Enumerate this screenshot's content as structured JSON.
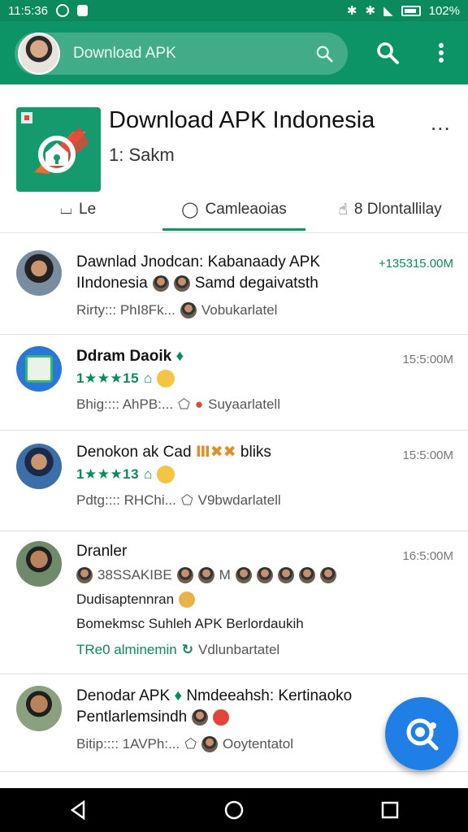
{
  "status_bar": {
    "time": "11:5:36",
    "battery": "102%"
  },
  "app_bar": {
    "search_placeholder": "Download APK"
  },
  "header": {
    "title": "Download APK Indonesia",
    "subtitle": "1: Sakm",
    "more": "...",
    "tabs": [
      {
        "label": "Le"
      },
      {
        "label": "Camleaoias"
      },
      {
        "label": "8 Dlontallilay"
      }
    ]
  },
  "items": [
    {
      "name_line1": "Dawnlad Jnodcan: Kabanaady APK",
      "name_line2": "IIndonesia",
      "name_line2_tail": "Samd degaivatsth",
      "time": "+135315.00M",
      "meta_left": "Rirty::: PhI8Fk...",
      "meta_right": "Vobukarlatel"
    },
    {
      "name_line1": "Ddram Daoik",
      "stars": "1★★★15",
      "time": "15:5:00M",
      "meta_left": "Bhig:::: AhPB:...",
      "meta_right": "Suyaarlatell"
    },
    {
      "name_line1": "Denokon ak Cad",
      "name_tail": "bliks",
      "stars": "1★★★13",
      "time": "15:5:00M",
      "meta_left": "Pdtg:::: RHChi...",
      "meta_right": "V9bwdarlatell"
    },
    {
      "name_line1": "Dranler",
      "line2": "38SSAKIBE",
      "line2_mid": "M",
      "line3": "Dudisaptennran",
      "line4": "Bomekmsc Suhleh APK Berlordaukih",
      "time": "16:5:00M",
      "meta_left": "TRe0 alminemin",
      "meta_right": "Vdlunbartatel"
    },
    {
      "name_line1": "Denodar APK",
      "name_line1_tail": "Nmdeeahsh: Kertinaoko",
      "name_line2": "Pentlarlemsindh",
      "meta_left": "Bitip:::: 1AVPh:...",
      "meta_right": "Ooytentatol"
    }
  ]
}
